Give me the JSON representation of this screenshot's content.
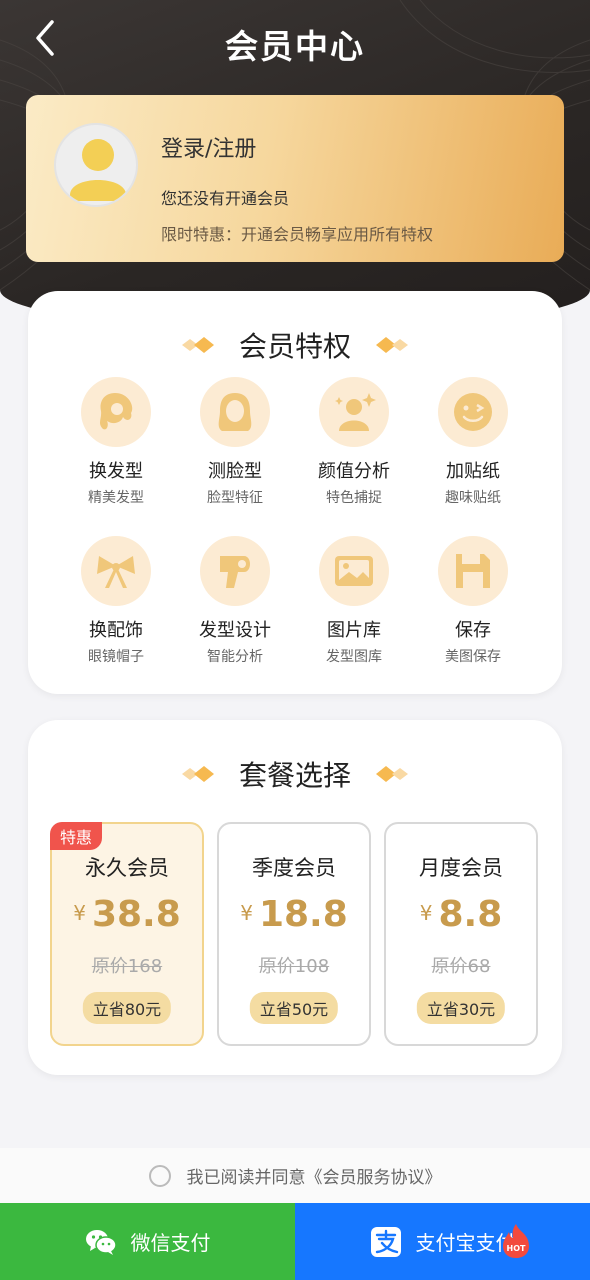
{
  "header": {
    "title": "会员中心"
  },
  "user": {
    "login_label": "登录/注册",
    "status": "您还没有开通会员",
    "promo": "限时特惠：开通会员畅享应用所有特权"
  },
  "privileges": {
    "title": "会员特权",
    "items": [
      {
        "name": "换发型",
        "sub": "精美发型",
        "icon": "hairstyle-icon"
      },
      {
        "name": "测脸型",
        "sub": "脸型特征",
        "icon": "face-shape-icon"
      },
      {
        "name": "颜值分析",
        "sub": "特色捕捉",
        "icon": "beauty-analysis-icon"
      },
      {
        "name": "加贴纸",
        "sub": "趣味贴纸",
        "icon": "sticker-icon"
      },
      {
        "name": "换配饰",
        "sub": "眼镜帽子",
        "icon": "bow-icon"
      },
      {
        "name": "发型设计",
        "sub": "智能分析",
        "icon": "hair-dryer-icon"
      },
      {
        "name": "图片库",
        "sub": "发型图库",
        "icon": "image-icon"
      },
      {
        "name": "保存",
        "sub": "美图保存",
        "icon": "save-icon"
      }
    ]
  },
  "packages": {
    "title": "套餐选择",
    "currency": "¥",
    "items": [
      {
        "name": "永久会员",
        "price": "38.8",
        "original": "原价168",
        "save": "立省80元",
        "badge": "特惠",
        "selected": true
      },
      {
        "name": "季度会员",
        "price": "18.8",
        "original": "原价108",
        "save": "立省50元",
        "badge": "",
        "selected": false
      },
      {
        "name": "月度会员",
        "price": "8.8",
        "original": "原价68",
        "save": "立省30元",
        "badge": "",
        "selected": false
      }
    ]
  },
  "agreement": {
    "text": "我已阅读并同意《会员服务协议》"
  },
  "payment": {
    "wechat_label": "微信支付",
    "alipay_label": "支付宝支付",
    "hot_label": "HOT"
  },
  "colors": {
    "accent_gold": "#c89b4d",
    "badge_red": "#f0544c",
    "wechat_green": "#3bb83f",
    "alipay_blue": "#1677ff"
  }
}
